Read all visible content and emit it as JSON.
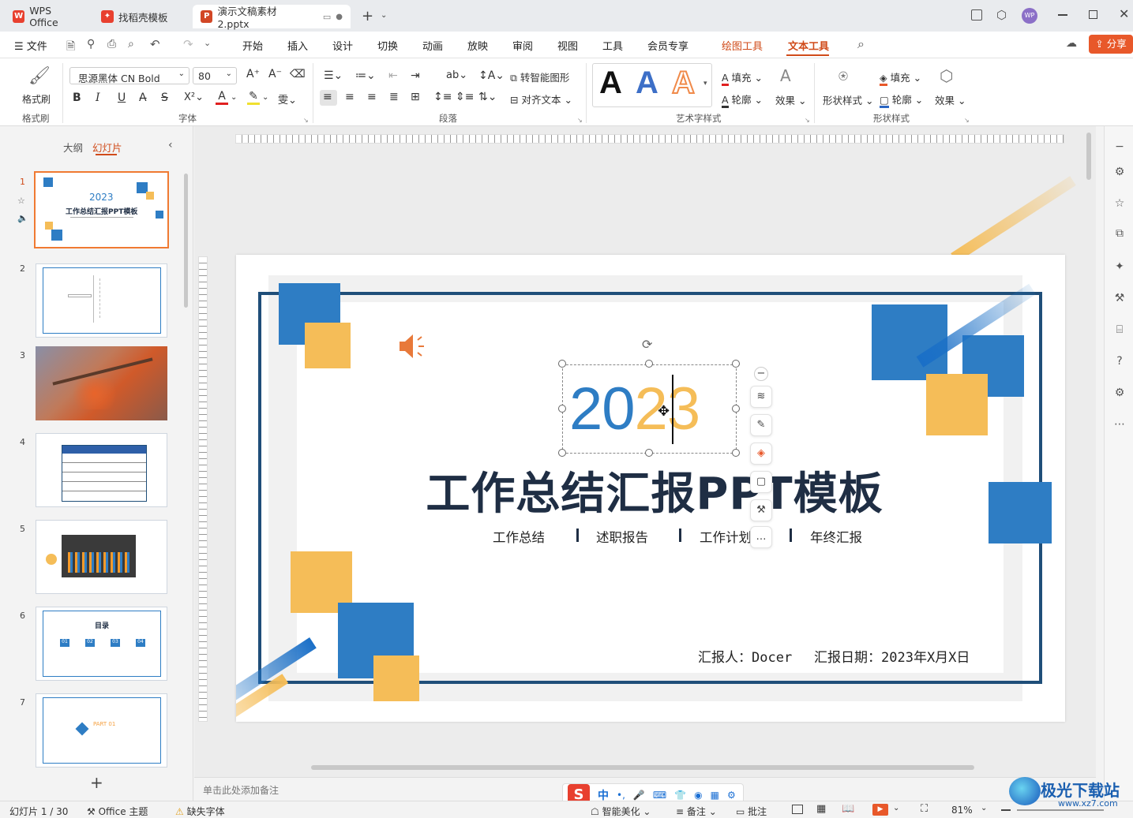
{
  "tabs": [
    {
      "label": "WPS Office"
    },
    {
      "label": "找稻壳模板"
    },
    {
      "label": "演示文稿素材2.pptx"
    }
  ],
  "menu": {
    "file": "文件",
    "items": [
      "开始",
      "插入",
      "设计",
      "切换",
      "动画",
      "放映",
      "审阅",
      "视图",
      "工具",
      "会员专享",
      "绘图工具",
      "文本工具"
    ],
    "share": "分享",
    "avatar": "WP"
  },
  "ribbon": {
    "format_painter": "格式刷",
    "group_format_painter": "格式刷",
    "font_name": "思源黑体 CN Bold",
    "font_size": "80",
    "group_font": "字体",
    "smart_shape": "转智能图形",
    "align_text": "对齐文本",
    "group_paragraph": "段落",
    "group_art_text": "艺术字样式",
    "fill": "填充",
    "outline": "轮廓",
    "effect": "效果",
    "shape_style": "形状样式",
    "shape_fill": "填充",
    "shape_outline": "轮廓",
    "shape_effect": "效果",
    "group_shape_style": "形状样式"
  },
  "sidebar": {
    "tab_outline": "大纲",
    "tab_slides": "幻灯片",
    "slides": [
      {
        "num": "1",
        "year": "2023",
        "title": "工作总结汇报PPT模板"
      },
      {
        "num": "2"
      },
      {
        "num": "3"
      },
      {
        "num": "4"
      },
      {
        "num": "5"
      },
      {
        "num": "6",
        "title": "目录",
        "items": [
          "01",
          "02",
          "03",
          "04"
        ]
      },
      {
        "num": "7",
        "part": "PART 01"
      }
    ]
  },
  "slide": {
    "year": {
      "d1": "20",
      "d2": "2",
      "d3": "3"
    },
    "title": "工作总结汇报PPT模板",
    "subtitles": [
      "工作总结",
      "述职报告",
      "工作计划",
      "年终汇报"
    ],
    "reporter": "汇报人：Docer",
    "date": "汇报日期：2023年X月X日"
  },
  "notes_placeholder": "单击此处添加备注",
  "status": {
    "slide_info": "幻灯片 1 / 30",
    "theme": "Office 主题",
    "missing_font": "缺失字体",
    "beautify": "智能美化",
    "notes": "备注",
    "comments": "批注",
    "zoom": "81%"
  },
  "ime": {
    "mode": "中"
  },
  "watermark": "极光下载站",
  "watermark_url": "www.xz7.com",
  "colors": {
    "accent": "#e8582a",
    "blue": "#2e7dc4",
    "yellow": "#f5bd58",
    "navy": "#1f4e79",
    "active_tab": "#d04b1a"
  }
}
